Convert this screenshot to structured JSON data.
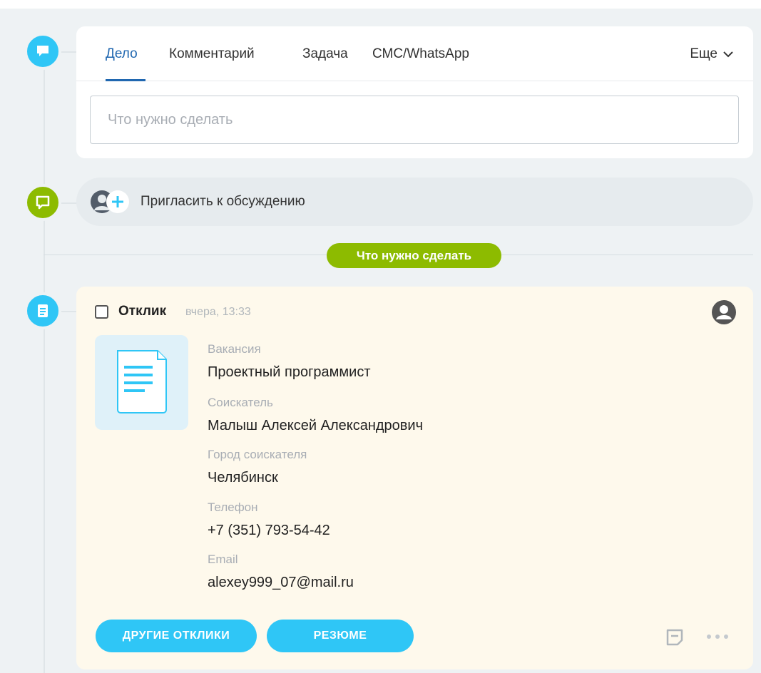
{
  "editor": {
    "tabs": [
      {
        "label": "Дело",
        "active": true
      },
      {
        "label": "Комментарий",
        "active": false
      },
      {
        "label": "Задача",
        "active": false
      },
      {
        "label": "СМС/WhatsApp",
        "active": false
      }
    ],
    "more_label": "Еще",
    "input_placeholder": "Что нужно сделать"
  },
  "invite": {
    "label": "Пригласить к обсуждению"
  },
  "divider_badge": "Что нужно сделать",
  "activity": {
    "title": "Отклик",
    "time": "вчера, 13:33",
    "fields": [
      {
        "label": "Вакансия",
        "value": "Проектный программист"
      },
      {
        "label": "Соискатель",
        "value": "Малыш Алексей Александрович"
      },
      {
        "label": "Город соискателя",
        "value": "Челябинск"
      },
      {
        "label": "Телефон",
        "value": "+7 (351) 793-54-42"
      },
      {
        "label": "Email",
        "value": "alexey999_07@mail.ru"
      }
    ],
    "buttons": {
      "other": "ДРУГИЕ ОТКЛИКИ",
      "resume": "РЕЗЮМЕ"
    }
  },
  "colors": {
    "accent_blue": "#2fc6f6",
    "accent_green": "#8dbb00",
    "active_tab": "#2067b0",
    "card_bg": "#fef9ec"
  },
  "icons": {
    "timeline_1": "comment-icon",
    "timeline_2": "chat-icon",
    "timeline_3": "document-icon",
    "invite": "add-user-icon",
    "activity_user": "user-icon",
    "thumb": "document-icon",
    "note": "note-icon",
    "more": "more-dots-icon",
    "chevron": "chevron-down-icon"
  }
}
